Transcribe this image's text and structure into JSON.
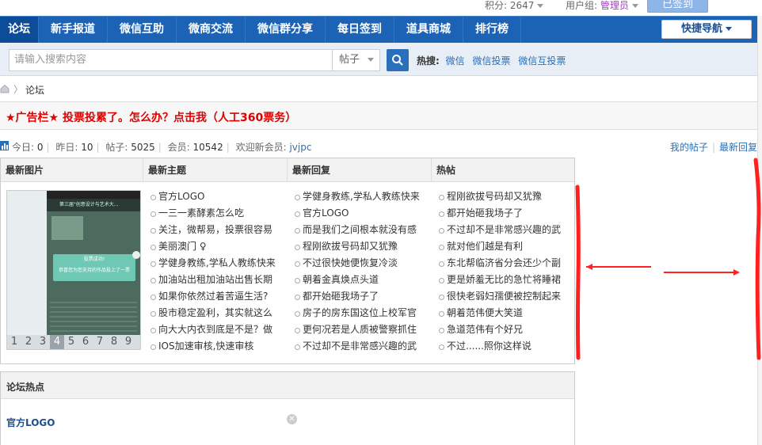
{
  "topbar": {
    "points_label": "积分: 2647",
    "usergroup_label": "用户组: ",
    "usergroup_value": "管理员",
    "signed_button": "已签到"
  },
  "nav": {
    "items": [
      {
        "label": "论坛",
        "active": true
      },
      {
        "label": "新手报道"
      },
      {
        "label": "微信互助"
      },
      {
        "label": "微商交流"
      },
      {
        "label": "微信群分享"
      },
      {
        "label": "每日签到"
      },
      {
        "label": "道具商城"
      },
      {
        "label": "排行榜"
      }
    ],
    "quick_nav": "快捷导航"
  },
  "search": {
    "placeholder": "请输入搜索内容",
    "type_selected": "帖子",
    "hot_label": "热搜:",
    "hot_keywords": [
      "微信",
      "微信投票",
      "微信互投票"
    ]
  },
  "breadcrumb": {
    "sep": "〉",
    "current": "论坛"
  },
  "ad": {
    "text": "★广告栏★ 投票投累了。怎么办？点击我（人工360票务）"
  },
  "stats": {
    "today_label": "今日: ",
    "today": "0",
    "yesterday_label": "昨日: ",
    "yesterday": "10",
    "posts_label": "帖子: ",
    "posts": "5025",
    "members_label": "会员: ",
    "members": "10542",
    "welcome_label": "欢迎新会员: ",
    "new_member": "jvjpc",
    "my_posts": "我的帖子",
    "latest_replies": "最新回复"
  },
  "panel": {
    "headers": [
      "最新图片",
      "最新主题",
      "最新回复",
      "热帖"
    ],
    "pager": [
      "1",
      "2",
      "3",
      "4",
      "5",
      "6",
      "7",
      "8",
      "9"
    ],
    "pager_current": "4",
    "phone": {
      "bar_text": "第三届\"创意设计与艺术大...",
      "modal_title": "投票成功!",
      "modal_sub": "恭喜您为您支持的作品投上了一票"
    },
    "new_topics": [
      "官方LOGO",
      "一三一素酵素怎么吃",
      "关注，微帮易，投票很容易",
      "美丽澳门 ♀",
      "学健身教练,学私人教练快来",
      "加油站出租加油站出售长期",
      "如果你依然过着苦逼生活?",
      "股市稳定盈利，其实就这么",
      "向大大内衣到底是不是？做",
      "IOS加速审核,快速审核"
    ],
    "new_replies": [
      "学健身教练,学私人教练快来",
      "官方LOGO",
      "而是我们之间根本就没有感",
      "程刚欲拔号码却又犹豫",
      "不过很快她便恢复冷淡",
      "朝着金真焕点头道",
      "都开始砸我场子了",
      "房子的房东国这位上校军官",
      "更何况若是人质被警察抓住",
      "不过却不是非常感兴趣的武"
    ],
    "hot_posts": [
      "程刚欲拔号码却又犹豫",
      "都开始砸我场子了",
      "不过却不是非常感兴趣的武",
      "就对他们越是有利",
      "东北帮临济省分会还少个副",
      "更是娇羞无比的急忙将睡裙",
      "很快老弱妇孺便被控制起来",
      "朝着范伟便大笑道",
      "急道范伟有个好兄",
      "不过......照你这样说"
    ]
  },
  "forum_hot": {
    "title": "论坛热点",
    "item": "官方LOGO"
  },
  "colors": {
    "nav_bg": "#1c63b6",
    "annotation_red": "#ff2020",
    "ad_red": "#e00000",
    "link_blue": "#2a6fb9"
  }
}
